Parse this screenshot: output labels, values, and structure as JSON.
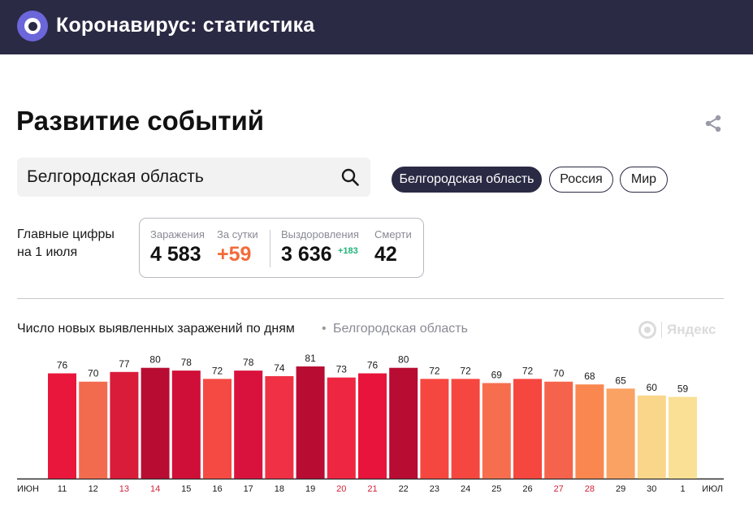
{
  "header": {
    "title": "Коронавирус: статистика"
  },
  "page": {
    "title": "Развитие событий"
  },
  "search": {
    "value": "Белгородская область"
  },
  "regions": [
    {
      "label": "Белгородская область",
      "active": true
    },
    {
      "label": "Россия",
      "active": false
    },
    {
      "label": "Мир",
      "active": false
    }
  ],
  "summary": {
    "label_line1": "Главные цифры",
    "label_line2": "на 1 июля",
    "infections_caption": "Заражения",
    "infections_value": "4 583",
    "daily_caption": "За сутки",
    "daily_value": "+59",
    "recovered_caption": "Выздоровления",
    "recovered_value": "3 636",
    "recovered_delta": "+183",
    "deaths_caption": "Смерти",
    "deaths_value": "42"
  },
  "chart_section": {
    "title": "Число новых выявленных заражений по дням",
    "separator": "•",
    "region": "Белгородская область",
    "watermark": "Яндекс"
  },
  "colors": {
    "header_bg": "#2a2a45",
    "weekend_label": "#d0213a",
    "recovered_delta": "#1fb37a",
    "daily_value": "#f26b3a"
  },
  "chart_data": {
    "type": "bar",
    "title": "Число новых выявленных заражений по дням",
    "x_start_label": "ИЮН",
    "x_end_label": "ИЮЛ",
    "categories": [
      "11",
      "12",
      "13",
      "14",
      "15",
      "16",
      "17",
      "18",
      "19",
      "20",
      "21",
      "22",
      "23",
      "24",
      "25",
      "26",
      "27",
      "28",
      "29",
      "30",
      "1"
    ],
    "values": [
      76,
      70,
      77,
      80,
      78,
      72,
      78,
      74,
      81,
      73,
      76,
      80,
      72,
      72,
      69,
      72,
      70,
      68,
      65,
      60,
      59
    ],
    "weekend": [
      false,
      false,
      true,
      true,
      false,
      false,
      false,
      false,
      false,
      true,
      true,
      false,
      false,
      false,
      false,
      false,
      true,
      true,
      false,
      false,
      false
    ],
    "bar_colors": [
      "#e8173b",
      "#f36b4f",
      "#d91c3a",
      "#b80c33",
      "#cf0f37",
      "#f54a43",
      "#d9123d",
      "#ef3045",
      "#b80c33",
      "#ef2642",
      "#e8143b",
      "#b80c33",
      "#f5473f",
      "#f5473f",
      "#f76e4f",
      "#f5473f",
      "#f6634c",
      "#f9874f",
      "#faa264",
      "#fad68a",
      "#f9e095"
    ],
    "ylim": [
      0,
      85
    ],
    "grid": false,
    "legend": "none"
  }
}
